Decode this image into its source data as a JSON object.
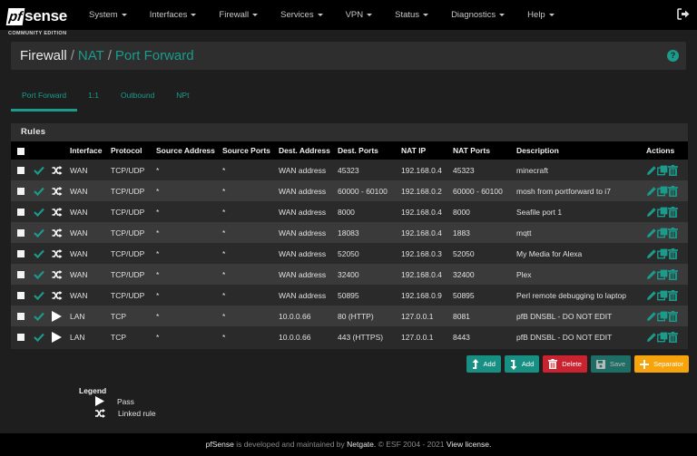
{
  "brand": {
    "logo_prefix": "pf",
    "logo_suffix": "sense",
    "edition": "COMMUNITY EDITION"
  },
  "nav": {
    "items": [
      {
        "label": "System"
      },
      {
        "label": "Interfaces"
      },
      {
        "label": "Firewall"
      },
      {
        "label": "Services"
      },
      {
        "label": "VPN"
      },
      {
        "label": "Status"
      },
      {
        "label": "Diagnostics"
      },
      {
        "label": "Help"
      }
    ],
    "logout_icon": "sign-out-icon"
  },
  "breadcrumb": {
    "items": [
      "Firewall",
      "NAT",
      "Port Forward"
    ],
    "separator": "/",
    "help_icon": "question-circle-icon",
    "help_glyph": "?"
  },
  "tabs": [
    {
      "label": "Port Forward",
      "active": true
    },
    {
      "label": "1:1",
      "active": false
    },
    {
      "label": "Outbound",
      "active": false
    },
    {
      "label": "NPt",
      "active": false
    }
  ],
  "panel": {
    "title": "Rules",
    "columns": [
      "Interface",
      "Protocol",
      "Source Address",
      "Source Ports",
      "Dest. Address",
      "Dest. Ports",
      "NAT IP",
      "NAT Ports",
      "Description",
      "Actions"
    ],
    "rows": [
      {
        "type": "linked",
        "interface": "WAN",
        "protocol": "TCP/UDP",
        "src_addr": "*",
        "src_ports": "*",
        "dst_addr": "WAN address",
        "dst_ports": "45323",
        "nat_ip": "192.168.0.4",
        "nat_ports": "45323",
        "description": "minecraft"
      },
      {
        "type": "linked",
        "interface": "WAN",
        "protocol": "TCP/UDP",
        "src_addr": "*",
        "src_ports": "*",
        "dst_addr": "WAN address",
        "dst_ports": "60000 - 60100",
        "nat_ip": "192.168.0.2",
        "nat_ports": "60000 - 60100",
        "description": "mosh from portforward to i7"
      },
      {
        "type": "linked",
        "interface": "WAN",
        "protocol": "TCP/UDP",
        "src_addr": "*",
        "src_ports": "*",
        "dst_addr": "WAN address",
        "dst_ports": "8000",
        "nat_ip": "192.168.0.4",
        "nat_ports": "8000",
        "description": "Seafile port 1"
      },
      {
        "type": "linked",
        "interface": "WAN",
        "protocol": "TCP/UDP",
        "src_addr": "*",
        "src_ports": "*",
        "dst_addr": "WAN address",
        "dst_ports": "18083",
        "nat_ip": "192.168.0.4",
        "nat_ports": "1883",
        "description": "mqtt"
      },
      {
        "type": "linked",
        "interface": "WAN",
        "protocol": "TCP/UDP",
        "src_addr": "*",
        "src_ports": "*",
        "dst_addr": "WAN address",
        "dst_ports": "52050",
        "nat_ip": "192.168.0.3",
        "nat_ports": "52050",
        "description": "My Media for Alexa"
      },
      {
        "type": "linked",
        "interface": "WAN",
        "protocol": "TCP/UDP",
        "src_addr": "*",
        "src_ports": "*",
        "dst_addr": "WAN address",
        "dst_ports": "32400",
        "nat_ip": "192.168.0.4",
        "nat_ports": "32400",
        "description": "Plex"
      },
      {
        "type": "linked",
        "interface": "WAN",
        "protocol": "TCP/UDP",
        "src_addr": "*",
        "src_ports": "*",
        "dst_addr": "WAN address",
        "dst_ports": "50895",
        "nat_ip": "192.168.0.9",
        "nat_ports": "50895",
        "description": "Perl remote debugging to laptop"
      },
      {
        "type": "pass",
        "interface": "LAN",
        "protocol": "TCP",
        "src_addr": "*",
        "src_ports": "*",
        "dst_addr": "10.0.0.66",
        "dst_ports": "80 (HTTP)",
        "nat_ip": "127.0.0.1",
        "nat_ports": "8081",
        "description": "pfB DNSBL - DO NOT EDIT"
      },
      {
        "type": "pass",
        "interface": "LAN",
        "protocol": "TCP",
        "src_addr": "*",
        "src_ports": "*",
        "dst_addr": "10.0.0.66",
        "dst_ports": "443 (HTTPS)",
        "nat_ip": "127.0.0.1",
        "nat_ports": "8443",
        "description": "pfB DNSBL - DO NOT EDIT"
      }
    ]
  },
  "buttons": {
    "add_top": "Add",
    "add_bottom": "Add",
    "delete": "Delete",
    "save": "Save",
    "separator": "Separator"
  },
  "legend": {
    "title": "Legend",
    "items": [
      {
        "icon": "play-icon",
        "label": "Pass"
      },
      {
        "icon": "random-icon",
        "label": "Linked rule"
      }
    ]
  },
  "footer": {
    "brand": "pfSense",
    "text1": " is developed and maintained by ",
    "company": "Netgate.",
    "text2": " © ESF 2004 - 2021 ",
    "license": "View license."
  },
  "colors": {
    "accent": "#1a9b8c",
    "danger": "#c9232f",
    "warning": "#f7a30c",
    "navbar": "#000000",
    "background": "#1e1e1e"
  }
}
